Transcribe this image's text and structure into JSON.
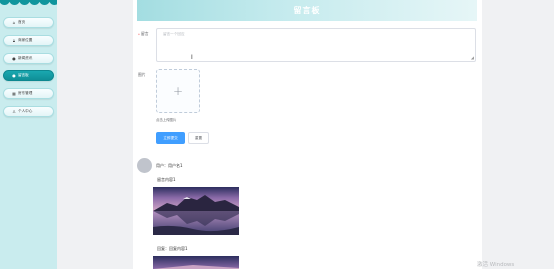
{
  "page": {
    "title": "留言板"
  },
  "sidebar": {
    "items": [
      {
        "label": "首页",
        "icon": "home-icon",
        "active": false
      },
      {
        "label": "商家位置",
        "icon": "lock-icon",
        "active": false
      },
      {
        "label": "新闻资讯",
        "icon": "dot-icon",
        "active": false
      },
      {
        "label": "留言板",
        "icon": "dot-icon",
        "active": true
      },
      {
        "label": "房东管理",
        "icon": "building-icon",
        "active": false
      },
      {
        "label": "个人中心",
        "icon": "user-icon",
        "active": false
      }
    ]
  },
  "form": {
    "message_label": "留言",
    "message_placeholder": "留言一个回应",
    "image_label": "图片",
    "upload_hint": "点击上传图片",
    "submit_label": "立即提交",
    "reset_label": "重置"
  },
  "comment": {
    "user_line": "用户：用户名1",
    "message_title": "留言内容1",
    "reply_title": "回复：回复内容1"
  },
  "watermark": "激活 Windows",
  "colors": {
    "accent": "#10959d",
    "primary": "#409eff",
    "sidebar_bg": "#c9ecee"
  }
}
